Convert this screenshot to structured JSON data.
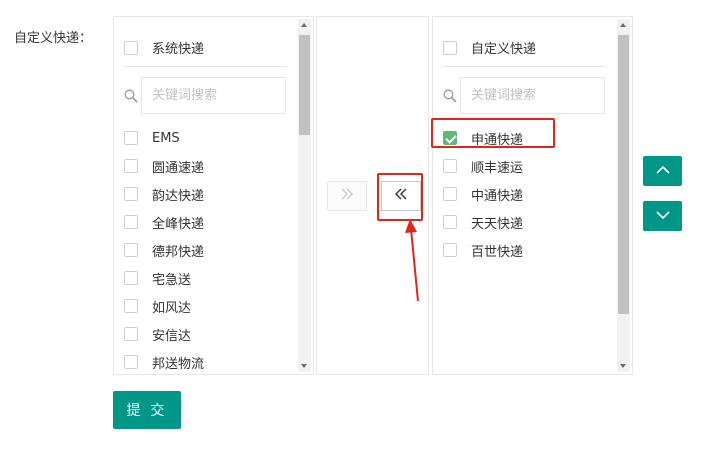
{
  "form": {
    "field_label": "自定义快递：",
    "submit_label": "提 交"
  },
  "left_panel": {
    "header_label": "系统快递",
    "search_placeholder": "关键词搜索",
    "items": [
      "EMS",
      "圆通速递",
      "韵达快递",
      "全峰快递",
      "德邦快递",
      "宅急送",
      "如风达",
      "安信达",
      "邦送物流"
    ]
  },
  "right_panel": {
    "header_label": "自定义快递",
    "search_placeholder": "关键词搜索",
    "items": [
      {
        "label": "申通快递",
        "checked": true
      },
      {
        "label": "顺丰速运",
        "checked": false
      },
      {
        "label": "中通快递",
        "checked": false
      },
      {
        "label": "天天快递",
        "checked": false
      },
      {
        "label": "百世快递",
        "checked": false
      }
    ]
  },
  "icons": {
    "move_right": "double-chevron-right-icon",
    "move_left": "double-chevron-left-icon",
    "move_up": "chevron-up-icon",
    "move_down": "chevron-down-icon",
    "search": "search-icon"
  },
  "colors": {
    "accent": "#009688",
    "checked": "#5fb878",
    "annotation": "#e1251b"
  }
}
